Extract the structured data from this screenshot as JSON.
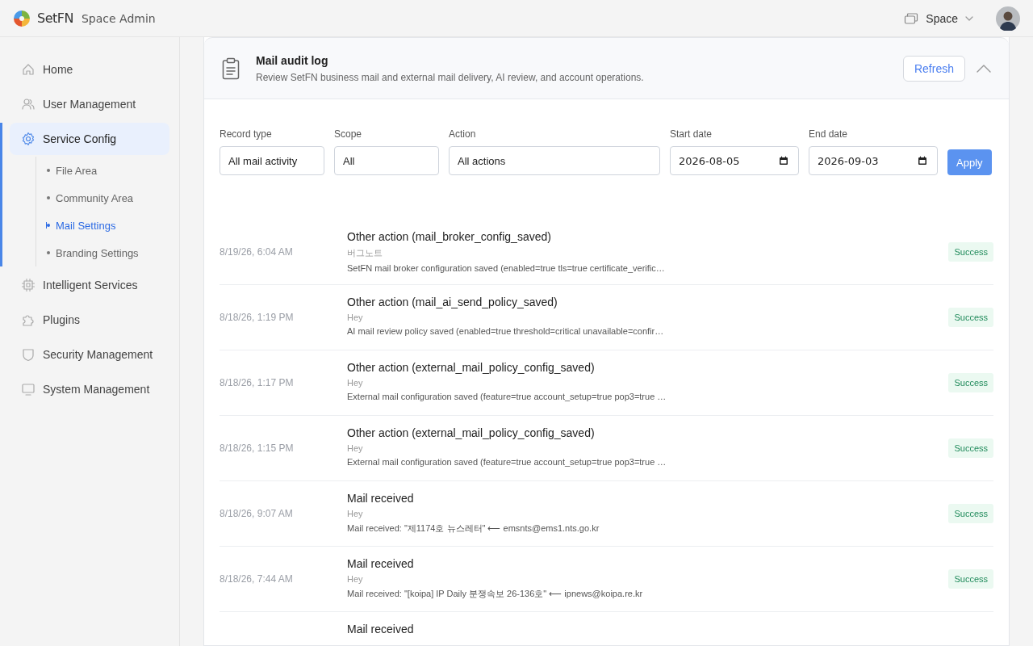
{
  "header": {
    "brand": "SetFN",
    "app_title": "Space Admin",
    "space_switcher": {
      "label": "Space"
    }
  },
  "sidebar": {
    "items": [
      {
        "label": "Home",
        "selected": false
      },
      {
        "label": "User Management",
        "selected": false
      },
      {
        "label": "Service Config",
        "selected": true,
        "expanded": true,
        "children": [
          {
            "label": "File Area",
            "selected": false
          },
          {
            "label": "Community Area",
            "selected": false
          },
          {
            "label": "Mail Settings",
            "selected": true
          },
          {
            "label": "Branding Settings",
            "selected": false
          }
        ]
      },
      {
        "label": "Intelligent Services",
        "selected": false
      },
      {
        "label": "Plugins",
        "selected": false
      },
      {
        "label": "Security Management",
        "selected": false
      },
      {
        "label": "System Management",
        "selected": false
      }
    ]
  },
  "panel": {
    "title": "Mail audit log",
    "subtitle": "Review SetFN business mail and external mail delivery, AI review, and account operations.",
    "refresh_button": "Refresh",
    "expanded": true
  },
  "filters": [
    {
      "label": "Record type",
      "kind": "select",
      "value": "All mail activity"
    },
    {
      "label": "Scope",
      "kind": "select",
      "value": "All"
    },
    {
      "label": "Action",
      "kind": "select",
      "value": "All actions"
    },
    {
      "label": "Start date",
      "kind": "date",
      "value": "2026-08-05"
    },
    {
      "label": "End date",
      "kind": "date",
      "value": "2026-09-03"
    }
  ],
  "apply_button": "Apply",
  "log_rows": [
    {
      "time": "8/19/26, 6:04 AM",
      "title": "Other action (mail_broker_config_saved)",
      "actor": "버그노트",
      "detail": "SetFN mail broker configuration saved (enabled=true tls=true certificate_verific…",
      "status": "Success"
    },
    {
      "time": "8/18/26, 1:19 PM",
      "title": "Other action (mail_ai_send_policy_saved)",
      "actor": "Hey",
      "detail": "AI mail review policy saved (enabled=true threshold=critical unavailable=confir…",
      "status": "Success"
    },
    {
      "time": "8/18/26, 1:17 PM",
      "title": "Other action (external_mail_policy_config_saved)",
      "actor": "Hey",
      "detail": "External mail configuration saved (feature=true account_setup=true pop3=true …",
      "status": "Success"
    },
    {
      "time": "8/18/26, 1:15 PM",
      "title": "Other action (external_mail_policy_config_saved)",
      "actor": "Hey",
      "detail": "External mail configuration saved (feature=true account_setup=true pop3=true …",
      "status": "Success"
    },
    {
      "time": "8/18/26, 9:07 AM",
      "title": "Mail received",
      "actor": "Hey",
      "detail": "Mail received: \"제1174호 뉴스레터\" ⟵ emsnts@ems1.nts.go.kr",
      "status": "Success"
    },
    {
      "time": "8/18/26, 7:44 AM",
      "title": "Mail received",
      "actor": "Hey",
      "detail": "Mail received: \"[koipa] IP Daily 분쟁속보 26-136호\" ⟵ ipnews@koipa.re.kr",
      "status": "Success"
    },
    {
      "title": "Mail received"
    }
  ]
}
